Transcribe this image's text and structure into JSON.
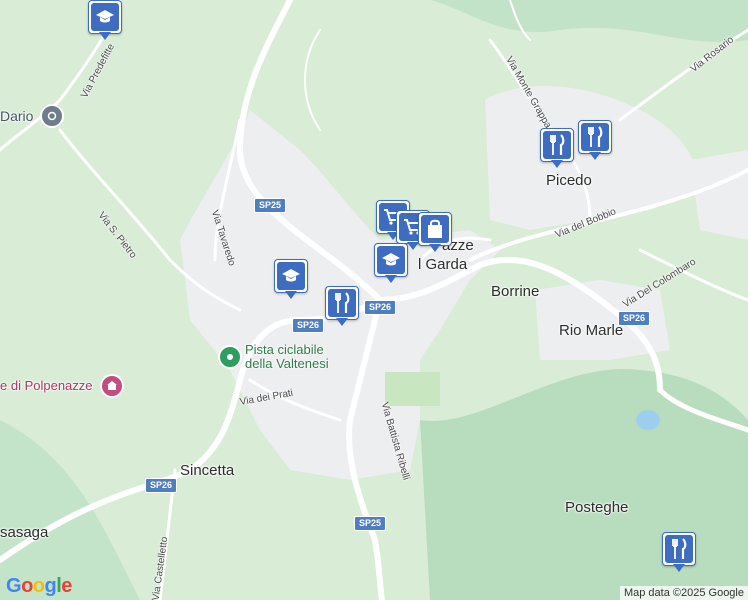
{
  "map": {
    "colors": {
      "land": "#d8ecd6",
      "forest": "#bfe0c4",
      "urban": "#eeeef0",
      "road": "#ffffff",
      "water": "#9ccfee",
      "field": "#c8e6c0",
      "shield": "#4f7fc0",
      "pin": "#3d6cc0"
    },
    "places": {
      "picedo": "Picedo",
      "borrine": "Borrine",
      "rio_marle": "Rio Marle",
      "sincetta": "Sincetta",
      "posteghe": "Posteghe",
      "polpenazze_line1": "azze",
      "polpenazze_line2": "l Garda",
      "sasaga": "sasaga"
    },
    "streets": {
      "predefitte": "Via Predefitte",
      "tavaredo": "Via Tavaredo",
      "s_pietro": "Via S. Pietro",
      "prati": "Via dei Prati",
      "castelletto": "Via Castelletto",
      "ribelli": "Via Battista Ribelli",
      "monte_grappa": "Via Monte Grappa",
      "rosario": "Via Rosario",
      "bobbio": "Via del Bobbio",
      "colombaro": "Via Del Colombaro"
    },
    "shields": {
      "sp25_top": "SP25",
      "sp26_center": "SP26",
      "sp26_left": "SP26",
      "sp26_bottom_left": "SP26",
      "sp25_bottom": "SP25",
      "sp26_right": "SP26"
    },
    "pois": {
      "pista": "Pista ciclabile\ndella Valtenesi",
      "dario": "Dario",
      "polpenazze": "e di Polpenazze"
    },
    "markers": {
      "school_top": "school-icon",
      "school_left": "school-icon",
      "school_center": "school-icon",
      "restaurant_center": "restaurant-icon",
      "restaurant_picedo_1": "restaurant-icon",
      "restaurant_picedo_2": "restaurant-icon",
      "restaurant_bottom": "restaurant-icon",
      "cart_1": "cart-icon",
      "cart_2": "cart-icon",
      "shopping": "shopping-bag-icon"
    },
    "attribution": "Map data ©2025 Google",
    "logo": "Google"
  }
}
